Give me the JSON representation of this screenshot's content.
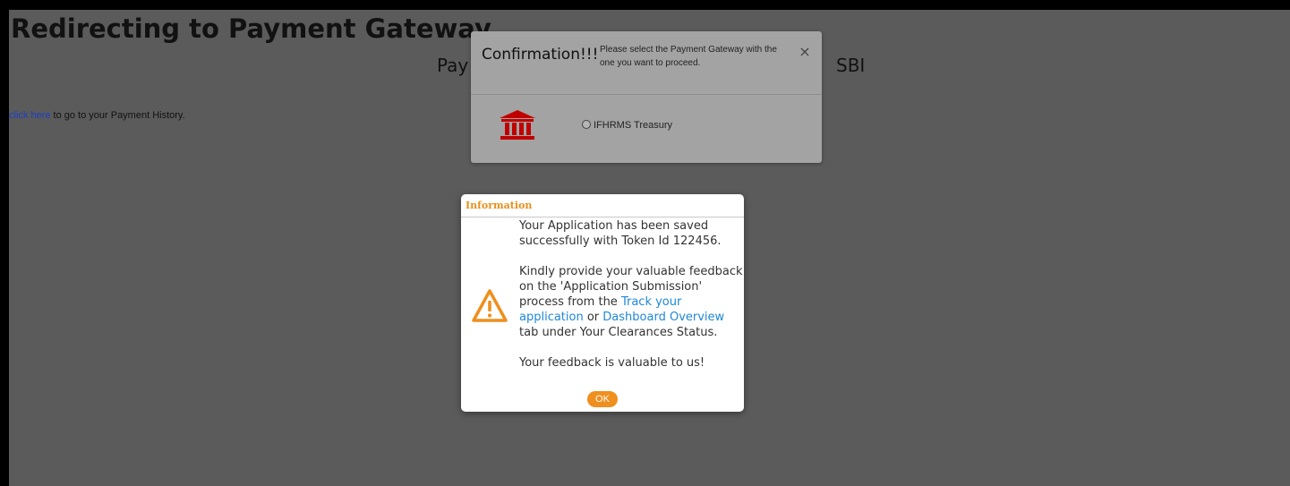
{
  "page": {
    "title": "Redirecting to Payment Gateway...",
    "subheading_left": "Pay",
    "subheading_right": "SBI",
    "history_link": "click here",
    "history_text": " to go to your Payment History."
  },
  "confirm": {
    "title": "Confirmation!!!",
    "message": "Please select the Payment Gateway with the one you want to proceed.",
    "close_symbol": "×",
    "options": [
      {
        "label": "IFHRMS Treasury",
        "selected": false,
        "icon": "bank-icon"
      }
    ],
    "icon_color": "#c00000"
  },
  "info": {
    "title": "Information",
    "saved_message": "Your Application has been saved successfully with Token Id 122456.",
    "feedback_text_1": "Kindly provide your valuable feedback on the 'Application Submission' process from the ",
    "link_track": "Track your application",
    "feedback_text_2": " or ",
    "link_dashboard": "Dashboard Overview",
    "feedback_text_3": " tab under Your Clearances Status.",
    "closing": "Your feedback is valuable to us!",
    "ok_label": "OK",
    "icon": "warning-icon",
    "accent_color": "#ef8f1e",
    "link_color": "#1e88d8"
  }
}
